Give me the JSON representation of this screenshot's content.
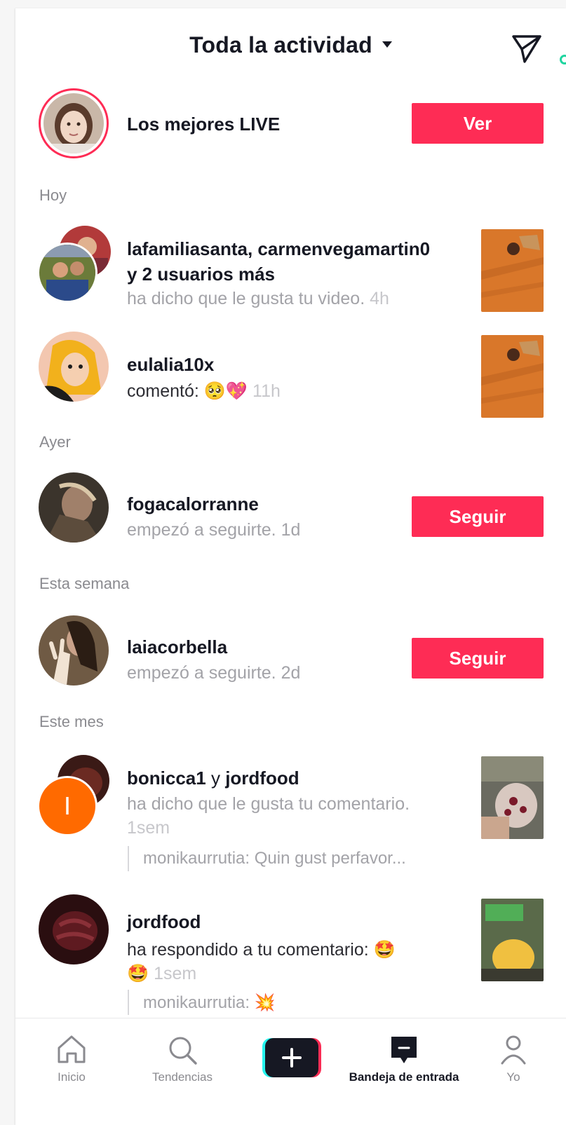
{
  "header": {
    "title": "Toda la actividad"
  },
  "live": {
    "label": "Los mejores LIVE",
    "button": "Ver"
  },
  "sections": {
    "today": "Hoy",
    "yesterday": "Ayer",
    "this_week": "Esta semana",
    "this_month": "Este mes"
  },
  "notifications": [
    {
      "users": "lafamiliasanta, carmenvegamartin0",
      "users_more": "y 2 usuarios más",
      "action": "ha dicho que le gusta tu video.",
      "time": "4h"
    },
    {
      "users": "eulalia10x",
      "action": "comentó:",
      "emoji": "🥺💖",
      "time": "11h"
    },
    {
      "users": "fogacalorranne",
      "action": "empezó a seguirte.",
      "time": "1d",
      "button": "Seguir"
    },
    {
      "users": "laiacorbella",
      "action": "empezó a seguirte.",
      "time": "2d",
      "button": "Seguir"
    },
    {
      "users_a": "bonicca1",
      "users_join": "y",
      "users_b": "jordfood",
      "action": "ha dicho que le gusta tu comentario.",
      "time": "1sem",
      "quote": "monikaurrutia: Quin gust perfavor...",
      "avatar_letter": "I"
    },
    {
      "users": "jordfood",
      "action": "ha respondido a tu comentario:",
      "emoji_a": "🤩",
      "emoji_b": "🤩",
      "time": "1sem",
      "quote": "monikaurrutia:",
      "quote_emoji": "💥"
    }
  ],
  "nav": {
    "home": "Inicio",
    "discover": "Tendencias",
    "inbox": "Bandeja de entrada",
    "profile": "Yo"
  },
  "colors": {
    "accent": "#fe2c55",
    "text": "#161823",
    "muted": "#a3a3a8",
    "online_dot": "#20d5a0"
  },
  "icons": {
    "header_send": "send-icon",
    "home": "home-icon",
    "discover": "search-icon",
    "create": "plus-icon",
    "inbox": "inbox-icon",
    "profile": "person-icon"
  }
}
